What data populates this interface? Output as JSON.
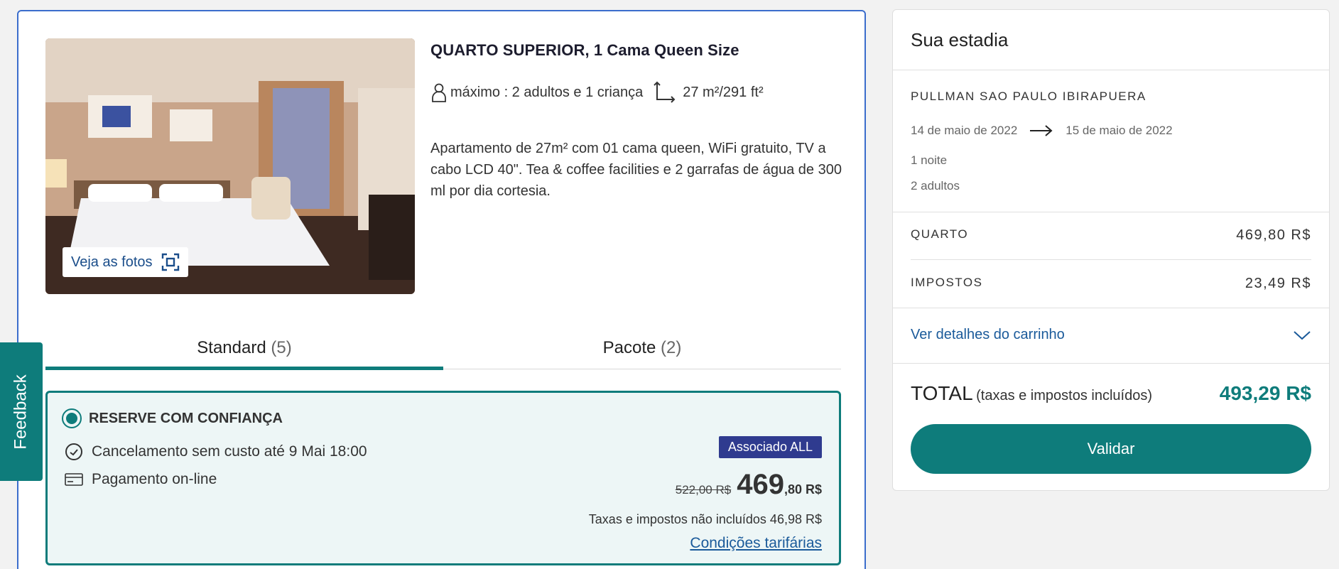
{
  "room": {
    "title": "QUARTO SUPERIOR, 1 Cama Queen Size",
    "occupancy": "máximo : 2 adultos e 1 criança",
    "size": "27 m²/291 ft²",
    "description": "Apartamento de 27m² com 01 cama queen, WiFi gratuito, TV a cabo LCD 40\". Tea & coffee facilities e 2 garrafas de água de 300 ml por dia cortesia.",
    "photos_button": "Veja as fotos"
  },
  "tabs": [
    {
      "label": "Standard",
      "count": "(5)",
      "active": true
    },
    {
      "label": "Pacote",
      "count": "(2)",
      "active": false
    }
  ],
  "rate": {
    "title": "RESERVE COM CONFIANÇA",
    "cancellation": "Cancelamento sem custo até 9 Mai 18:00",
    "payment": "Pagamento on-line",
    "badge": "Associado ALL",
    "old_price": "522,00 R$",
    "price_integer": "469",
    "price_decimal": ",80 R$",
    "tax_note": "Taxas e impostos não incluídos 46,98 R$",
    "conditions_link": "Condições tarifárias"
  },
  "feedback": "Feedback",
  "summary": {
    "title": "Sua estadia",
    "hotel": "PULLMAN SAO PAULO IBIRAPUERA",
    "checkin": "14 de maio de 2022",
    "checkout": "15 de maio de 2022",
    "nights": "1 noite",
    "guests": "2 adultos",
    "room_label": "QUARTO",
    "room_amount": "469,80 R$",
    "taxes_label": "IMPOSTOS",
    "taxes_amount": "23,49 R$",
    "cart_link": "Ver detalhes do carrinho",
    "total_label": "TOTAL",
    "total_note": "(taxas e impostos incluídos)",
    "total_amount": "493,29 R$",
    "validate_button": "Validar"
  },
  "colors": {
    "accent": "#0e7c7b",
    "link": "#1a5a9a",
    "badge": "#2f3b8f",
    "card_border": "#3b6dcc"
  }
}
